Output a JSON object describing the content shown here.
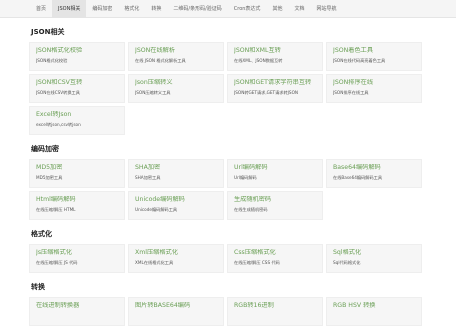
{
  "nav": [
    {
      "label": "首页",
      "active": false
    },
    {
      "label": "JSON相关",
      "active": true
    },
    {
      "label": "编码加密",
      "active": false
    },
    {
      "label": "格式化",
      "active": false
    },
    {
      "label": "转换",
      "active": false
    },
    {
      "label": "二维码/条形码/验证码",
      "active": false
    },
    {
      "label": "Cron表达式",
      "active": false
    },
    {
      "label": "其他",
      "active": false
    },
    {
      "label": "文档",
      "active": false
    },
    {
      "label": "网站导航",
      "active": false
    }
  ],
  "sections": [
    {
      "title": "JSON相关",
      "items": [
        {
          "title": "JSON格式化校验",
          "desc": "JSON格式化校验"
        },
        {
          "title": "JSON在线解析",
          "desc": "在线 JSON 格式化解析工具"
        },
        {
          "title": "JSON和XML互转",
          "desc": "在线XML、JSON数据互转"
        },
        {
          "title": "JSON着色工具",
          "desc": "JSON在线代码高亮着色工具"
        },
        {
          "title": "JSON和CSV互转",
          "desc": "JSON在线CSV转换工具"
        },
        {
          "title": "Json压缩转义",
          "desc": "JSON压缩转义工具"
        },
        {
          "title": "JSON和GET请求字符串互转",
          "desc": "JSON转GET请求,GET请求转JSON"
        },
        {
          "title": "JSON排序在线",
          "desc": "JSON排序在线工具"
        },
        {
          "title": "Excel转Json",
          "desc": "excel转json,csv转json"
        }
      ]
    },
    {
      "title": "编码加密",
      "items": [
        {
          "title": "MD5加密",
          "desc": "MD5加密工具"
        },
        {
          "title": "SHA加密",
          "desc": "SHA加密工具"
        },
        {
          "title": "Url编码解码",
          "desc": "Url编码解码"
        },
        {
          "title": "Base64编码解码",
          "desc": "在线Base64编码解码工具"
        },
        {
          "title": "Html编码解码",
          "desc": "在线压缩/解压 HTML"
        },
        {
          "title": "Unicode编码解码",
          "desc": "Unicode编码解码工具"
        },
        {
          "title": "生成随机密码",
          "desc": "在线生成随机密码"
        }
      ]
    },
    {
      "title": "格式化",
      "items": [
        {
          "title": "Js压缩格式化",
          "desc": "在线压缩/解压 JS 代码"
        },
        {
          "title": "Xml压缩格式化",
          "desc": "XML在线格式化工具"
        },
        {
          "title": "Css压缩格式化",
          "desc": "在线压缩/解压 CSS 代码"
        },
        {
          "title": "Sql格式化",
          "desc": "Sql代码格式化"
        }
      ]
    },
    {
      "title": "转换",
      "items": [
        {
          "title": "在线进制转换器",
          "desc": ""
        },
        {
          "title": "图片转BASE64编码",
          "desc": ""
        },
        {
          "title": "RGB转16进制",
          "desc": ""
        },
        {
          "title": "RGB HSV 转换",
          "desc": ""
        }
      ]
    }
  ]
}
